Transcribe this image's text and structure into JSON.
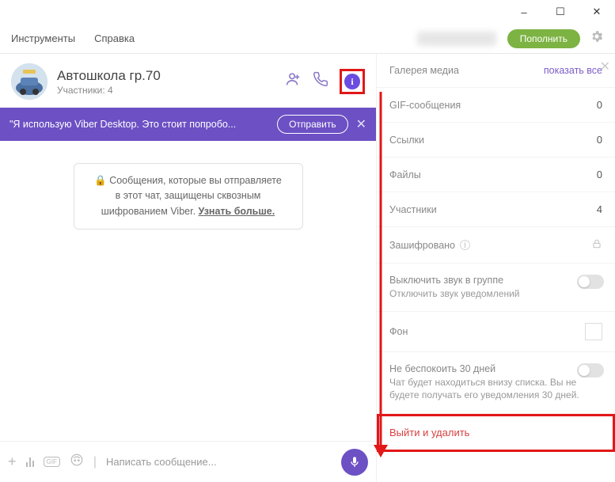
{
  "window": {
    "minimize": "–",
    "maximize": "☐",
    "close": "✕"
  },
  "menu": {
    "tools": "Инструменты",
    "help": "Справка"
  },
  "topbtn": {
    "topup": "Пополнить"
  },
  "chat": {
    "title": "Автошкола гр.70",
    "participants": "Участники: 4"
  },
  "banner": {
    "text": "\"Я использую Viber Desktop. Это стоит попробо...",
    "send": "Отправить"
  },
  "encryption": {
    "line1": "Сообщения, которые вы отправляете",
    "line2": "в этот чат, защищены сквозным",
    "line3_prefix": "шифрованием Viber. ",
    "learnmore": "Узнать больше."
  },
  "input": {
    "placeholder": "Написать сообщение..."
  },
  "panel": {
    "media": {
      "label": "Галерея медиа",
      "showall": "показать все"
    },
    "gif": {
      "label": "GIF-сообщения",
      "value": "0"
    },
    "links": {
      "label": "Ссылки",
      "value": "0"
    },
    "files": {
      "label": "Файлы",
      "value": "0"
    },
    "members": {
      "label": "Участники",
      "value": "4"
    },
    "encrypted": {
      "label": "Зашифровано"
    },
    "mute": {
      "label": "Выключить звук в группе",
      "sub": "Отключить звук уведомлений"
    },
    "bg": {
      "label": "Фон"
    },
    "dnd": {
      "label": "Не беспокоить 30 дней",
      "sub": "Чат будет находиться внизу списка. Вы не будете получать его уведомления 30 дней."
    },
    "leave": {
      "label": "Выйти и удалить"
    }
  }
}
